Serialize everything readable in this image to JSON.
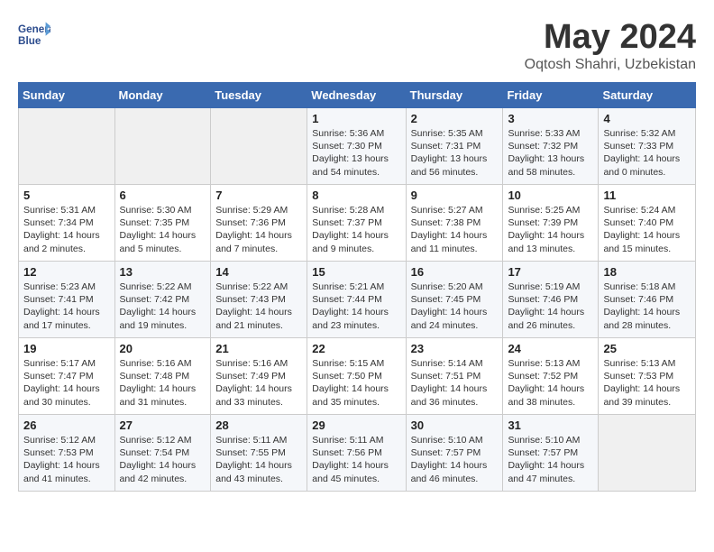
{
  "header": {
    "logo_line1": "General",
    "logo_line2": "Blue",
    "month_year": "May 2024",
    "location": "Oqtosh Shahri, Uzbekistan"
  },
  "weekdays": [
    "Sunday",
    "Monday",
    "Tuesday",
    "Wednesday",
    "Thursday",
    "Friday",
    "Saturday"
  ],
  "weeks": [
    [
      {
        "day": "",
        "info": ""
      },
      {
        "day": "",
        "info": ""
      },
      {
        "day": "",
        "info": ""
      },
      {
        "day": "1",
        "info": "Sunrise: 5:36 AM\nSunset: 7:30 PM\nDaylight: 13 hours\nand 54 minutes."
      },
      {
        "day": "2",
        "info": "Sunrise: 5:35 AM\nSunset: 7:31 PM\nDaylight: 13 hours\nand 56 minutes."
      },
      {
        "day": "3",
        "info": "Sunrise: 5:33 AM\nSunset: 7:32 PM\nDaylight: 13 hours\nand 58 minutes."
      },
      {
        "day": "4",
        "info": "Sunrise: 5:32 AM\nSunset: 7:33 PM\nDaylight: 14 hours\nand 0 minutes."
      }
    ],
    [
      {
        "day": "5",
        "info": "Sunrise: 5:31 AM\nSunset: 7:34 PM\nDaylight: 14 hours\nand 2 minutes."
      },
      {
        "day": "6",
        "info": "Sunrise: 5:30 AM\nSunset: 7:35 PM\nDaylight: 14 hours\nand 5 minutes."
      },
      {
        "day": "7",
        "info": "Sunrise: 5:29 AM\nSunset: 7:36 PM\nDaylight: 14 hours\nand 7 minutes."
      },
      {
        "day": "8",
        "info": "Sunrise: 5:28 AM\nSunset: 7:37 PM\nDaylight: 14 hours\nand 9 minutes."
      },
      {
        "day": "9",
        "info": "Sunrise: 5:27 AM\nSunset: 7:38 PM\nDaylight: 14 hours\nand 11 minutes."
      },
      {
        "day": "10",
        "info": "Sunrise: 5:25 AM\nSunset: 7:39 PM\nDaylight: 14 hours\nand 13 minutes."
      },
      {
        "day": "11",
        "info": "Sunrise: 5:24 AM\nSunset: 7:40 PM\nDaylight: 14 hours\nand 15 minutes."
      }
    ],
    [
      {
        "day": "12",
        "info": "Sunrise: 5:23 AM\nSunset: 7:41 PM\nDaylight: 14 hours\nand 17 minutes."
      },
      {
        "day": "13",
        "info": "Sunrise: 5:22 AM\nSunset: 7:42 PM\nDaylight: 14 hours\nand 19 minutes."
      },
      {
        "day": "14",
        "info": "Sunrise: 5:22 AM\nSunset: 7:43 PM\nDaylight: 14 hours\nand 21 minutes."
      },
      {
        "day": "15",
        "info": "Sunrise: 5:21 AM\nSunset: 7:44 PM\nDaylight: 14 hours\nand 23 minutes."
      },
      {
        "day": "16",
        "info": "Sunrise: 5:20 AM\nSunset: 7:45 PM\nDaylight: 14 hours\nand 24 minutes."
      },
      {
        "day": "17",
        "info": "Sunrise: 5:19 AM\nSunset: 7:46 PM\nDaylight: 14 hours\nand 26 minutes."
      },
      {
        "day": "18",
        "info": "Sunrise: 5:18 AM\nSunset: 7:46 PM\nDaylight: 14 hours\nand 28 minutes."
      }
    ],
    [
      {
        "day": "19",
        "info": "Sunrise: 5:17 AM\nSunset: 7:47 PM\nDaylight: 14 hours\nand 30 minutes."
      },
      {
        "day": "20",
        "info": "Sunrise: 5:16 AM\nSunset: 7:48 PM\nDaylight: 14 hours\nand 31 minutes."
      },
      {
        "day": "21",
        "info": "Sunrise: 5:16 AM\nSunset: 7:49 PM\nDaylight: 14 hours\nand 33 minutes."
      },
      {
        "day": "22",
        "info": "Sunrise: 5:15 AM\nSunset: 7:50 PM\nDaylight: 14 hours\nand 35 minutes."
      },
      {
        "day": "23",
        "info": "Sunrise: 5:14 AM\nSunset: 7:51 PM\nDaylight: 14 hours\nand 36 minutes."
      },
      {
        "day": "24",
        "info": "Sunrise: 5:13 AM\nSunset: 7:52 PM\nDaylight: 14 hours\nand 38 minutes."
      },
      {
        "day": "25",
        "info": "Sunrise: 5:13 AM\nSunset: 7:53 PM\nDaylight: 14 hours\nand 39 minutes."
      }
    ],
    [
      {
        "day": "26",
        "info": "Sunrise: 5:12 AM\nSunset: 7:53 PM\nDaylight: 14 hours\nand 41 minutes."
      },
      {
        "day": "27",
        "info": "Sunrise: 5:12 AM\nSunset: 7:54 PM\nDaylight: 14 hours\nand 42 minutes."
      },
      {
        "day": "28",
        "info": "Sunrise: 5:11 AM\nSunset: 7:55 PM\nDaylight: 14 hours\nand 43 minutes."
      },
      {
        "day": "29",
        "info": "Sunrise: 5:11 AM\nSunset: 7:56 PM\nDaylight: 14 hours\nand 45 minutes."
      },
      {
        "day": "30",
        "info": "Sunrise: 5:10 AM\nSunset: 7:57 PM\nDaylight: 14 hours\nand 46 minutes."
      },
      {
        "day": "31",
        "info": "Sunrise: 5:10 AM\nSunset: 7:57 PM\nDaylight: 14 hours\nand 47 minutes."
      },
      {
        "day": "",
        "info": ""
      }
    ]
  ]
}
